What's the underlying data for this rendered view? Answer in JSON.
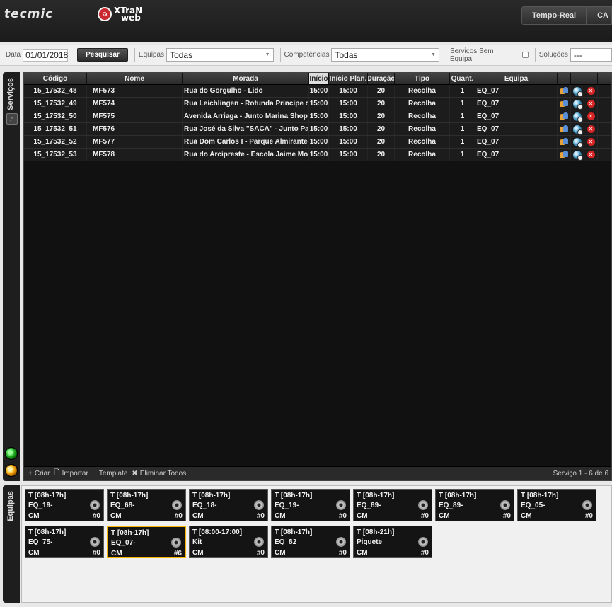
{
  "header": {
    "logo_tecmic": "tecmic",
    "xtran_line1": "XTraN",
    "xtran_line2": "web",
    "tabs": [
      "Tempo-Real",
      "CA"
    ]
  },
  "filters": {
    "date_label": "Data",
    "date_value": "01/01/2018",
    "search_button": "Pesquisar",
    "equipas_label": "Equipas",
    "equipas_value": "Todas",
    "competencias_label": "Competências",
    "competencias_value": "Todas",
    "sem_equipa_label": "Serviços Sem Equipa",
    "solucoes_label": "Soluções",
    "solucoes_value": "---"
  },
  "side": {
    "servicos_label": "Serviços",
    "equipas_label": "Equipas"
  },
  "grid": {
    "columns": [
      "Código",
      "Nome",
      "Morada",
      "Início",
      "Início Plan.",
      "Duração",
      "Tipo",
      "Quant.",
      "Equipa"
    ],
    "rows": [
      {
        "codigo": "15_17532_48",
        "nome": "MF573",
        "morada": "Rua do Gorgulho - Lido",
        "inicio": "15:00",
        "plan": "15:00",
        "duracao": "20",
        "tipo": "Recolha",
        "quant": "1",
        "equipa": "EQ_07"
      },
      {
        "codigo": "15_17532_49",
        "nome": "MF574",
        "morada": "Rua Leichlingen - Rotunda Principe do",
        "inicio": "15:00",
        "plan": "15:00",
        "duracao": "20",
        "tipo": "Recolha",
        "quant": "1",
        "equipa": "EQ_07"
      },
      {
        "codigo": "15_17532_50",
        "nome": "MF575",
        "morada": "Avenida Arriaga - Junto Marina Shoppi",
        "inicio": "15:00",
        "plan": "15:00",
        "duracao": "20",
        "tipo": "Recolha",
        "quant": "1",
        "equipa": "EQ_07"
      },
      {
        "codigo": "15_17532_51",
        "nome": "MF576",
        "morada": "Rua José da Silva \"SACA\" - Junto Parqu",
        "inicio": "15:00",
        "plan": "15:00",
        "duracao": "20",
        "tipo": "Recolha",
        "quant": "1",
        "equipa": "EQ_07"
      },
      {
        "codigo": "15_17532_52",
        "nome": "MF577",
        "morada": "Rua Dom Carlos I - Parque Almirante R",
        "inicio": "15:00",
        "plan": "15:00",
        "duracao": "20",
        "tipo": "Recolha",
        "quant": "1",
        "equipa": "EQ_07"
      },
      {
        "codigo": "15_17532_53",
        "nome": "MF578",
        "morada": "Rua do Arcipreste - Escola Jaime Moniz",
        "inicio": "15:00",
        "plan": "15:00",
        "duracao": "20",
        "tipo": "Recolha",
        "quant": "1",
        "equipa": "EQ_07"
      }
    ],
    "footer": {
      "criar": "Criar",
      "importar": "Importar",
      "template": "Template",
      "eliminar": "Eliminar Todos",
      "count": "Serviço 1 - 6 de 6"
    }
  },
  "teams": [
    {
      "shift": "T [08h-17h]",
      "name": "EQ_19-",
      "type": "CM",
      "count": "#0",
      "selected": false
    },
    {
      "shift": "T [08h-17h]",
      "name": "EQ_68-",
      "type": "CM",
      "count": "#0",
      "selected": false
    },
    {
      "shift": "T [08h-17h]",
      "name": "EQ_18-",
      "type": "CM",
      "count": "#0",
      "selected": false
    },
    {
      "shift": "T [08h-17h]",
      "name": "EQ_19-",
      "type": "CM",
      "count": "#0",
      "selected": false
    },
    {
      "shift": "T [08h-17h]",
      "name": "EQ_89-",
      "type": "CM",
      "count": "#0",
      "selected": false
    },
    {
      "shift": "T [08h-17h]",
      "name": "EQ_89-",
      "type": "CM",
      "count": "#0",
      "selected": false
    },
    {
      "shift": "T [08h-17h]",
      "name": "EQ_05-",
      "type": "CM",
      "count": "#0",
      "selected": false
    },
    {
      "shift": "T [08h-17h]",
      "name": "EQ_75-",
      "type": "CM",
      "count": "#0",
      "selected": false
    },
    {
      "shift": "T [08h-17h]",
      "name": "EQ_07-",
      "type": "CM",
      "count": "#6",
      "selected": true
    },
    {
      "shift": "T [08:00-17:00]",
      "name": "Kit",
      "type": "CM",
      "count": "#0",
      "selected": false
    },
    {
      "shift": "T [08h-17h]",
      "name": "EQ_82",
      "type": "CM",
      "count": "#0",
      "selected": false
    },
    {
      "shift": "T [08h-21h]",
      "name": "Piquete",
      "type": "CM",
      "count": "#0",
      "selected": false
    }
  ],
  "colors": {
    "selected_border": "#f5b400",
    "delete_red": "#d62424"
  }
}
